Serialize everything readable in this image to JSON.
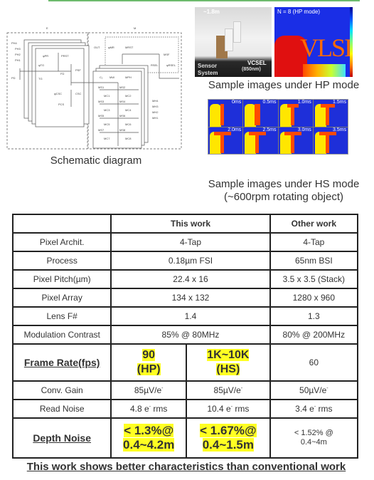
{
  "schematic": {
    "caption": "Schematic diagram",
    "block_labels": {
      "left": "E",
      "right": "M"
    },
    "left_labels": [
      "PH4",
      "PH3",
      "PH2",
      "PH1",
      "PD",
      "φTG",
      "TG",
      "φPR",
      "PRST",
      "FD",
      "PSF",
      "φCSC",
      "CSC",
      "PCS"
    ],
    "right_labels": [
      "OUT",
      "φMR",
      "MRST",
      "MSF",
      "RSEL",
      "φRSEL",
      "C₂",
      "MW",
      "MPH",
      "MS1",
      "MS2",
      "MC1",
      "MC2",
      "MS3",
      "MS4",
      "MC3",
      "MC4",
      "MS5",
      "MS6",
      "MC5",
      "MC6",
      "MS7",
      "MS8",
      "MC7",
      "MC8",
      "MH4",
      "MH3",
      "MH2",
      "MH1"
    ]
  },
  "hp_images": {
    "caption": "Sample images under HP mode",
    "photo_labels": {
      "distance": "~1.8m",
      "vcsel": "VCSEL",
      "vcsel_wl": "(850nm)",
      "sensor": "Sensor",
      "system": "System"
    },
    "depth_label": "N = 8 (HP mode)",
    "depth_text": "VLSI"
  },
  "hs_images": {
    "caption_line1": "Sample images under HS mode",
    "caption_line2": "(~600rpm rotating object)",
    "frames": [
      "0ms",
      "0.5ms",
      "1.0ms",
      "1.5ms",
      "2.0ms",
      "2.5ms",
      "3.0ms",
      "3.5ms"
    ]
  },
  "table": {
    "headers": [
      "",
      "This work",
      "Other work"
    ],
    "rows": [
      {
        "label": "Pixel Archit.",
        "this_work": "4-Tap",
        "other": "4-Tap"
      },
      {
        "label": "Process",
        "this_work": "0.18µm FSI",
        "other": "65nm BSI"
      },
      {
        "label": "Pixel Pitch(µm)",
        "this_work": "22.4 x 16",
        "other": "3.5 x 3.5 (Stack)"
      },
      {
        "label": "Pixel Array",
        "this_work": "134 x 132",
        "other": "1280 x 960"
      },
      {
        "label": "Lens F#",
        "this_work": "1.4",
        "other": "1.3"
      },
      {
        "label": "Modulation Contrast",
        "this_work": "85% @ 80MHz",
        "other": "80% @ 200MHz"
      }
    ],
    "frame_rate": {
      "label": "Frame Rate(fps)",
      "hp_line1": "90",
      "hp_line2": "(HP)",
      "hs_line1": "1K~10K",
      "hs_line2": "(HS)",
      "other": "60"
    },
    "conv_gain": {
      "label": "Conv. Gain",
      "hp": "85µV/e",
      "hs": "85µV/e",
      "other": "50µV/e",
      "sup": "-"
    },
    "read_noise": {
      "label": "Read Noise",
      "hp_val": "4.8 e",
      "hs_val": "10.4 e",
      "other_val": "3.4 e",
      "sup": "-",
      "unit": " rms"
    },
    "depth_noise": {
      "label": "Depth Noise",
      "hp_line1": "< 1.3%@",
      "hp_line2": "0.4~4.2m",
      "hs_line1": "< 1.67%@",
      "hs_line2": "0.4~1.5m",
      "other_line1": "< 1.52% @",
      "other_line2": "0.4~4m"
    }
  },
  "conclusion": "This work shows better characteristics than conventional work",
  "colors": {
    "highlight": "#ffff22",
    "accent_line": "#6dbb6d"
  }
}
